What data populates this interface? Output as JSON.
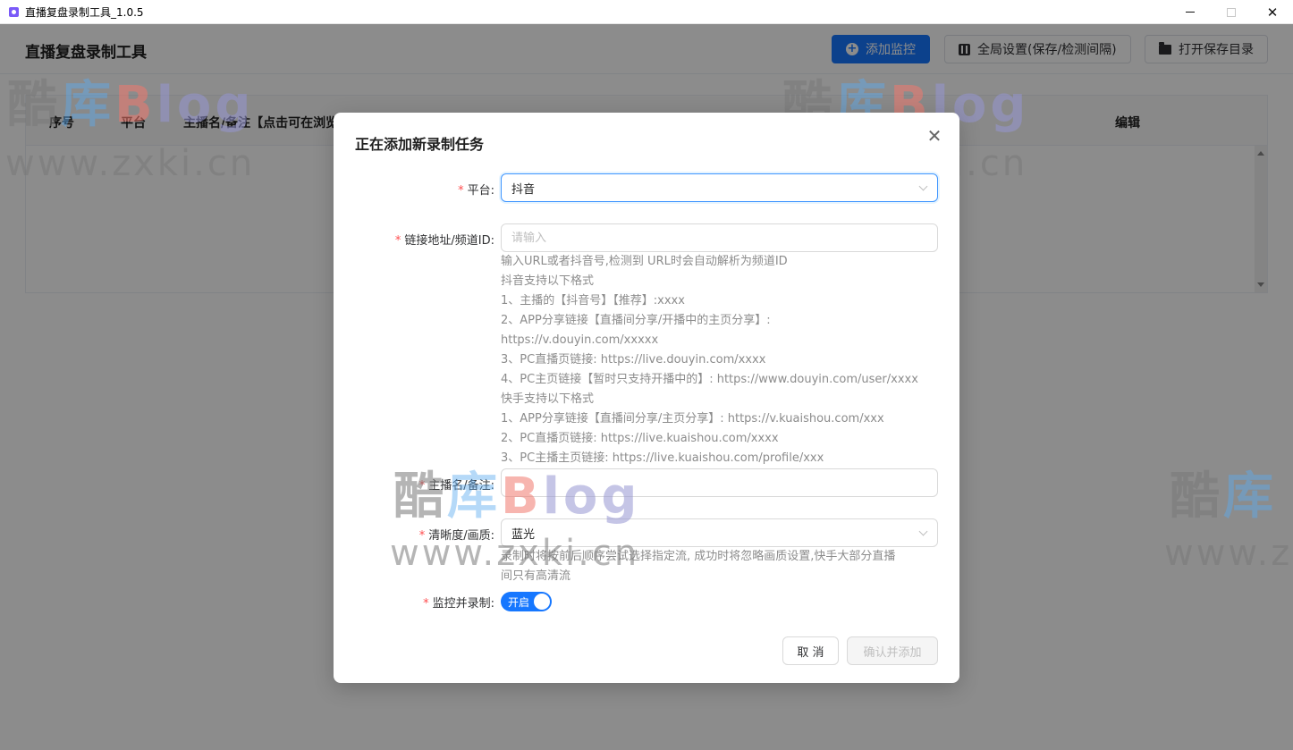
{
  "window": {
    "title": "直播复盘录制工具_1.0.5",
    "minimize_glyph": "—",
    "maximize_glyph": "□",
    "close_glyph": "✕"
  },
  "header": {
    "app_title": "直播复盘录制工具",
    "add_monitor_label": "添加监控",
    "global_settings_label": "全局设置(保存/检测间隔)",
    "open_folder_label": "打开保存目录"
  },
  "table": {
    "columns": [
      "序号",
      "平台",
      "主播名/备注【点击可在浏览",
      "编辑"
    ]
  },
  "watermark": {
    "ku": "酷",
    "ku2": "库",
    "b": "B",
    "log": "log",
    "url": "www.zxki.cn"
  },
  "dialog": {
    "title": "正在添加新录制任务",
    "close_glyph": "✕",
    "platform": {
      "label": "平台:",
      "value": "抖音"
    },
    "url": {
      "label": "链接地址/频道ID:",
      "value": "",
      "placeholder": "请输入",
      "help": [
        "输入URL或者抖音号,检测到 URL时会自动解析为频道ID",
        "抖音支持以下格式",
        "1、主播的【抖音号】【推荐】:xxxx",
        "2、APP分享链接【直播间分享/开播中的主页分享】:",
        "https://v.douyin.com/xxxxx",
        "3、PC直播页链接: https://live.douyin.com/xxxx",
        "4、PC主页链接【暂时只支持开播中的】: https://www.douyin.com/user/xxxx",
        "快手支持以下格式",
        "1、APP分享链接【直播间分享/主页分享】: https://v.kuaishou.com/xxx",
        "2、PC直播页链接: https://live.kuaishou.com/xxxx",
        "3、PC主播主页链接: https://live.kuaishou.com/profile/xxx"
      ]
    },
    "name": {
      "label": "主播名/备注:",
      "value": ""
    },
    "quality": {
      "label": "清晰度/画质:",
      "value": "蓝光",
      "help": [
        "录制时将按前后顺序尝试选择指定流, 成功时将忽略画质设置,快手大部分直播",
        "间只有高清流"
      ]
    },
    "monitor": {
      "label": "监控并录制:",
      "switch_text": "开启",
      "enabled": true
    },
    "cancel_label": "取 消",
    "confirm_label": "确认并添加"
  },
  "colors": {
    "primary": "#1677ff",
    "required": "#ff4d4f",
    "help_text": "#8c8c8c",
    "overlay": "rgba(0,0,0,0.45)"
  }
}
